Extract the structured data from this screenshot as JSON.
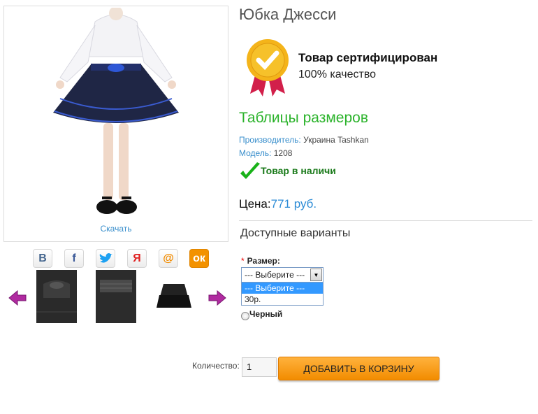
{
  "gallery": {
    "download_label": "Скачать",
    "social": [
      {
        "icon": "vk-icon",
        "glyph": "В"
      },
      {
        "icon": "facebook-icon",
        "glyph": "f"
      },
      {
        "icon": "twitter-icon",
        "glyph": "🐦"
      },
      {
        "icon": "moimir-icon",
        "glyph": "Я"
      },
      {
        "icon": "mail-ru-icon",
        "glyph": "@"
      },
      {
        "icon": "odnoklassniki-icon",
        "glyph": "ок"
      }
    ],
    "thumbnails_count": 3
  },
  "product": {
    "title": "Юбка Джесси",
    "certificate": {
      "title": "Товар сертифицирован",
      "subtitle": "100% качество"
    },
    "size_table_link": "Таблицы размеров",
    "maker_label": "Производитель:",
    "maker_value": "Украина Tashkan",
    "model_label": "Модель:",
    "model_value": "1208",
    "stock_text": "Товар в наличи",
    "price_label": "Цена:",
    "price_value": "771 руб."
  },
  "options": {
    "heading": "Доступные варианты",
    "size_required_mark": "*",
    "size_label": "Размер:",
    "size_selected": "--- Выберите ---",
    "size_options": [
      "--- Выберите ---",
      "30р."
    ],
    "color_label": "Черный"
  },
  "cart": {
    "qty_label": "Количество:",
    "qty_value": "1",
    "add_button": "ДОБАВИТЬ В КОРЗИНУ"
  },
  "colors": {
    "link": "#3a8fcc",
    "green": "#2bb32b",
    "price": "#2b8bd6",
    "button": "#f28c00"
  }
}
